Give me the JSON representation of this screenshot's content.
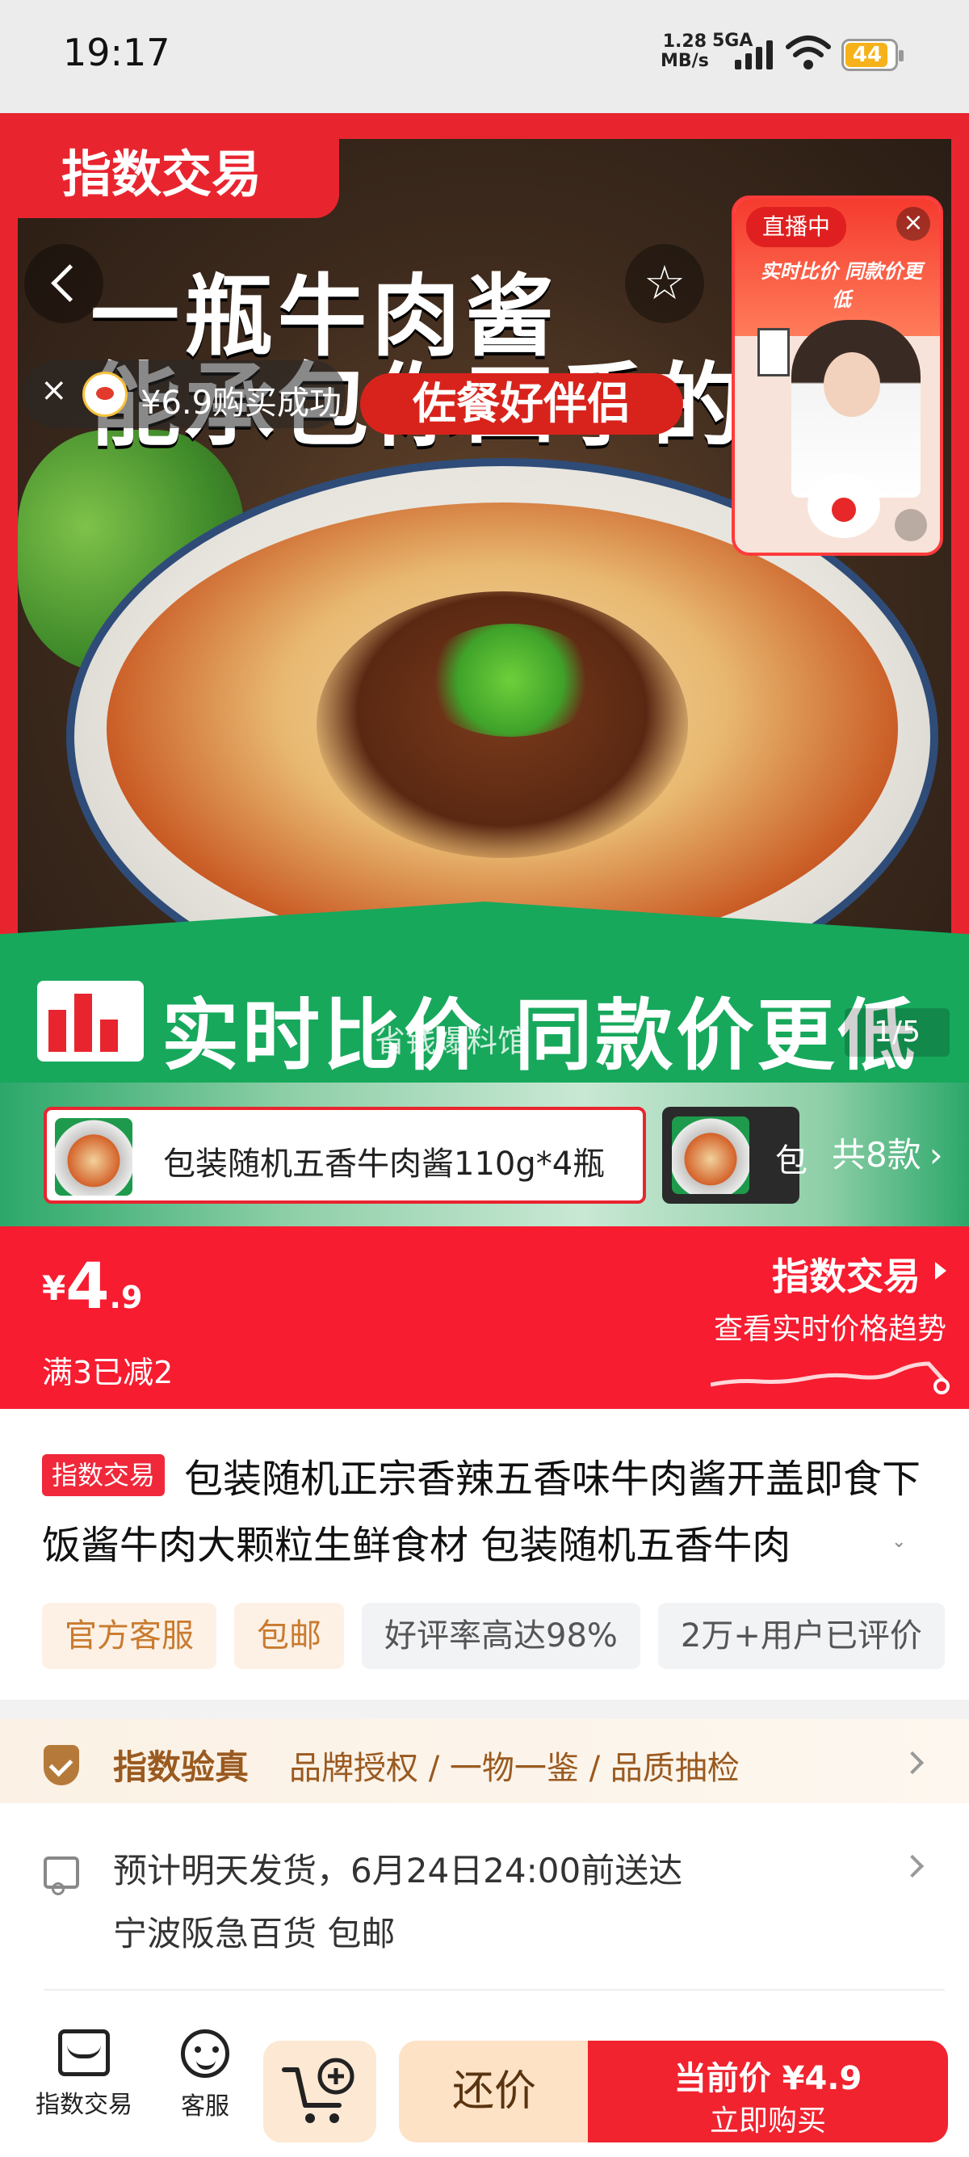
{
  "status_bar": {
    "time": "19:17",
    "net_speed_value": "1.28",
    "net_speed_unit": "MB/s",
    "network": "5GA",
    "battery": "44"
  },
  "hero": {
    "tag": "指数交易",
    "headline_line1": "一瓶牛肉酱",
    "headline_line2": "能承包你四季的",
    "sub_banner": "佐餐好伴侣",
    "purchase_toast": "¥6.9购买成功",
    "live_badge": "直播中",
    "live_title": "实时比价 同款价更低",
    "green_banner": "实时比价 同款价更低",
    "watermark": "省钱爆料馆",
    "pager": "1/5",
    "icons": {
      "back": "chevron-left-icon",
      "favorite": "star-icon",
      "close": "close-icon",
      "mute": "mute-icon"
    }
  },
  "sku": {
    "selected_label": "包装随机五香牛肉酱110g*4瓶",
    "next_label": "包",
    "count_label": "共8款"
  },
  "price_bar": {
    "currency": "¥",
    "price_int": "4",
    "price_dec": ".9",
    "discount": "满3已减2",
    "title": "指数交易",
    "subtitle": "查看实时价格趋势"
  },
  "product": {
    "tag": "指数交易",
    "title": "包装随机正宗香辣五香味牛肉酱开盖即食下饭酱牛肉大颗粒生鲜食材 包装随机五香牛肉",
    "chips": [
      "官方客服",
      "包邮",
      "好评率高达98%",
      "2万+用户已评价"
    ]
  },
  "verify": {
    "title": "指数验真",
    "desc": "品牌授权 / 一物一鉴 / 品质抽检"
  },
  "shipping": {
    "line1": "预计明天发货，6月24日24:00前送达",
    "line2": "宁波阪急百货 包邮"
  },
  "bottom_bar": {
    "store_label": "指数交易",
    "service_label": "客服",
    "bargain_label": "还价",
    "buy_line1": "当前价 ¥4.9",
    "buy_line2": "立即购买"
  },
  "colors": {
    "accent": "#f0232f",
    "green_banner": "#17a85c",
    "verify_text": "#9a5a20"
  }
}
